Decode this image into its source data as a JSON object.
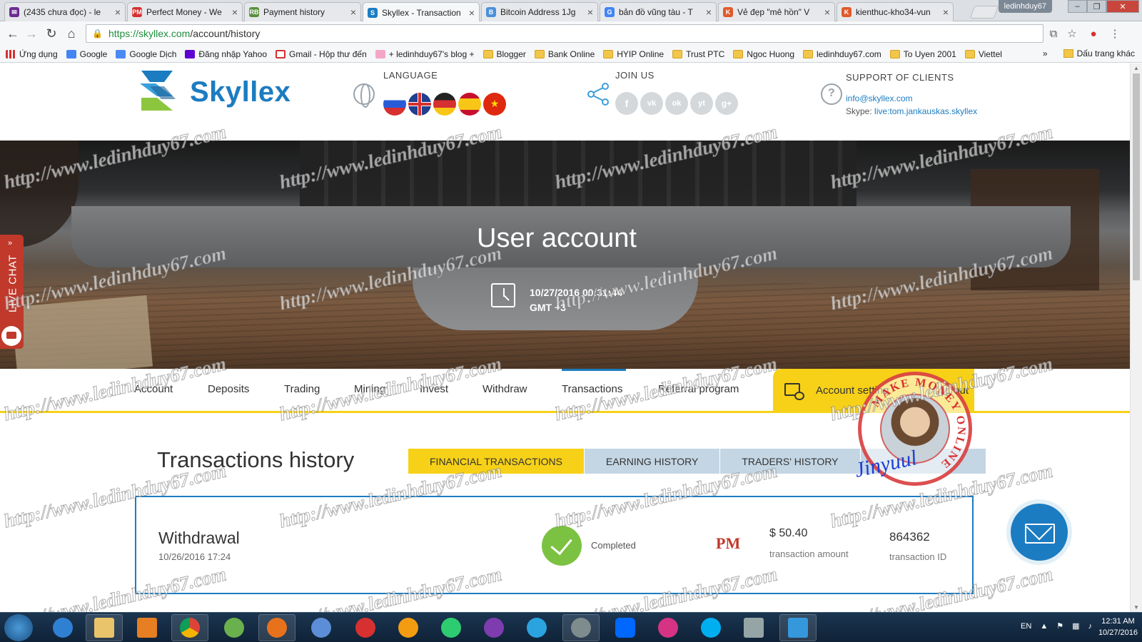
{
  "browser": {
    "tabs": [
      {
        "label": "(2435 chưa đọc) - le",
        "favicon_color": "#6b2c91",
        "icon": "mail-icon"
      },
      {
        "label": "Perfect Money - We",
        "favicon_color": "#d63031",
        "icon": "pm-icon"
      },
      {
        "label": "Payment history",
        "favicon_color": "#5a8f3c",
        "icon": "rb-icon"
      },
      {
        "label": "Skyllex - Transaction",
        "favicon_color": "#1c7cc1",
        "icon": "skyllex-icon",
        "active": true
      },
      {
        "label": "Bitcoin Address 1Jg",
        "favicon_color": "#4a90d9",
        "icon": "b-icon"
      },
      {
        "label": "bản đồ vũng tàu - T",
        "favicon_color": "#4285f4",
        "icon": "google-icon"
      },
      {
        "label": "Vẻ đẹp \"mê hồn\" V",
        "favicon_color": "#e05a2b",
        "icon": "k-icon"
      },
      {
        "label": "kienthuc-kho34-vun",
        "favicon_color": "#e05a2b",
        "icon": "k-icon"
      }
    ],
    "user": "ledinhduy67",
    "url_host": "https://skyllex.com",
    "url_path": "/account/history",
    "bookmarks": [
      {
        "label": "Ứng dụng",
        "icon": "apps-icon"
      },
      {
        "label": "Google",
        "icon": "google-icon"
      },
      {
        "label": "Google Dịch",
        "icon": "translate-icon"
      },
      {
        "label": "Đăng nhập Yahoo",
        "icon": "yahoo-icon"
      },
      {
        "label": "Gmail - Hộp thư đến",
        "icon": "gmail-icon"
      },
      {
        "label": "+ ledinhduy67's blog +",
        "icon": "blog-icon"
      },
      {
        "label": "Blogger",
        "icon": "folder-icon"
      },
      {
        "label": "Bank Online",
        "icon": "folder-icon"
      },
      {
        "label": "HYIP Online",
        "icon": "folder-icon"
      },
      {
        "label": "Trust PTC",
        "icon": "folder-icon"
      },
      {
        "label": "Ngoc Huong",
        "icon": "folder-icon"
      },
      {
        "label": "ledinhduy67.com",
        "icon": "folder-icon"
      },
      {
        "label": "To Uyen 2001",
        "icon": "folder-icon"
      },
      {
        "label": "Viettel",
        "icon": "folder-icon"
      }
    ],
    "bookmarks_more": "»",
    "other_bookmarks": "Dấu trang khác"
  },
  "site": {
    "logo_text": "Skyllex",
    "language_label": "LANGUAGE",
    "join_label": "JOIN US",
    "support_label": "SUPPORT OF CLIENTS",
    "support_email": "info@skyllex.com",
    "support_skype_prefix": "Skype: ",
    "support_skype": "live:tom.jankauskas.skyllex",
    "socials": [
      "f",
      "vk",
      "ok",
      "yt",
      "g+"
    ]
  },
  "hero": {
    "title": "User account",
    "datetime": "10/27/2016 00:31:44",
    "timezone": "GMT +3"
  },
  "live_chat": "LIVE CHAT",
  "nav": {
    "items": [
      "Account",
      "Deposits",
      "Trading",
      "Mining",
      "Invest",
      "Withdraw",
      "Transactions",
      "Referral program"
    ],
    "active": "Transactions",
    "account_settings": "Account setting",
    "logout": "Log out"
  },
  "history": {
    "title": "Transactions history",
    "subtabs": [
      "FINANCIAL TRANSACTIONS",
      "EARNING HISTORY",
      "TRADERS' HISTORY"
    ],
    "active_subtab": "FINANCIAL TRANSACTIONS",
    "transaction": {
      "type": "Withdrawal",
      "date": "10/26/2016 17:24",
      "status": "Completed",
      "method_logo": "PM",
      "amount": "$ 50.40",
      "amount_label": "transaction amount",
      "id": "864362",
      "id_label": "transaction ID"
    }
  },
  "watermark": "http://www.ledinhduy67.com",
  "stamp": {
    "ring_text": "MAKE MONEY ONLINE",
    "signature": "Jinyuul"
  },
  "taskbar": {
    "language": "EN",
    "time": "12:31 AM",
    "date": "10/27/2016"
  },
  "colors": {
    "brand_blue": "#1c7cc1",
    "accent_yellow": "#f7d117",
    "subtab_blue": "#c4d6e4",
    "success_green": "#7cc242",
    "live_chat_red": "#c0392b"
  }
}
